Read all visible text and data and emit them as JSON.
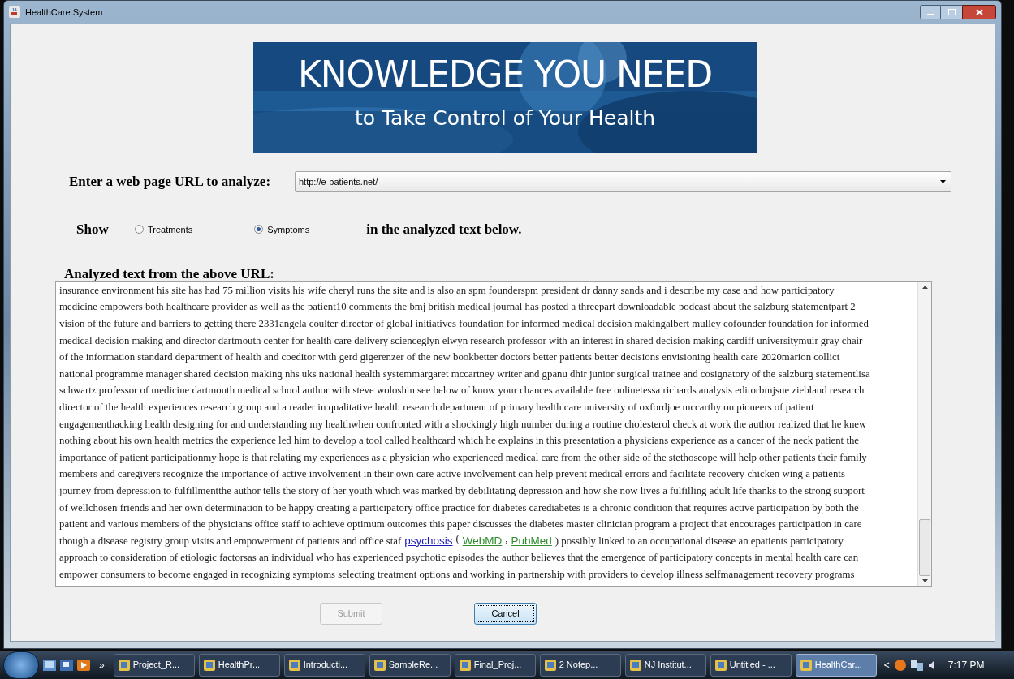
{
  "window": {
    "title": "HealthCare System"
  },
  "banner": {
    "kind": "picture",
    "headline": "KNOWLEDGE YOU NEED",
    "tagline": "to Take Control of Your Health"
  },
  "url_row": {
    "label": "Enter a web page URL to analyze:",
    "value": "http://e-patients.net/"
  },
  "show_row": {
    "label": "Show",
    "suffix": "in the analyzed text below.",
    "options": [
      {
        "label": "Treatments",
        "selected": false
      },
      {
        "label": "Symptoms",
        "selected": true
      }
    ]
  },
  "analyzed": {
    "heading": "Analyzed text from the above URL:",
    "lines": [
      [
        {
          "kind": "text",
          "text": "insurance environment his site has had 75 million visits his wife cheryl runs the site and is also an spm founderspm president dr danny sands and i describe my case and how participatory"
        }
      ],
      [
        {
          "kind": "text",
          "text": "medicine empowers both healthcare provider as well as the patient10 comments the bmj british medical journal has posted a threepart downloadable podcast about the salzburg statementpart 2"
        }
      ],
      [
        {
          "kind": "text",
          "text": "vision of the future and barriers to getting there 2331angela coulter director of global initiatives foundation for informed medical decision makingalbert mulley cofounder foundation for informed"
        }
      ],
      [
        {
          "kind": "text",
          "text": "medical decision making and director dartmouth center for health care delivery scienceglyn elwyn research professor with an interest in shared decision making cardiff universitymuir gray chair"
        }
      ],
      [
        {
          "kind": "text",
          "text": "of the information standard department of health and coeditor with gerd gigerenzer of the new bookbetter doctors better patients better decisions envisioning health care 2020marion collict"
        }
      ],
      [
        {
          "kind": "text",
          "text": "national programme manager shared decision making nhs uks national health systemmargaret mccartney writer and gpanu dhir junior surgical trainee and cosignatory of the salzburg statementlisa"
        }
      ],
      [
        {
          "kind": "text",
          "text": "schwartz professor of medicine dartmouth medical school author with steve woloshin see below of know your chances available free onlinetessa richards analysis editorbmjsue ziebland research"
        }
      ],
      [
        {
          "kind": "text",
          "text": "director of the health experiences research group and a reader in qualitative health research department of primary health care university of oxfordjoe mccarthy on pioneers of patient"
        }
      ],
      [
        {
          "kind": "text",
          "text": "engagementhacking health designing for and understanding my healthwhen confronted with a shockingly high number during a routine cholesterol check at work the author realized that he knew"
        }
      ],
      [
        {
          "kind": "text",
          "text": "nothing about his own health metrics the experience led him to develop a tool called healthcard which he explains in this presentation a physicians experience as a cancer of the neck patient the"
        }
      ],
      [
        {
          "kind": "text",
          "text": "importance of patient participationmy hope is that relating my experiences as a physician who experienced medical care from the other side of the stethoscope will help other patients their family"
        }
      ],
      [
        {
          "kind": "text",
          "text": "members and caregivers recognize the importance of active involvement in their own care active involvement can help prevent medical errors and facilitate recovery chicken wing a patients"
        }
      ],
      [
        {
          "kind": "text",
          "text": "journey from depression to fulfillmentthe author tells the story of her youth which was marked by debilitating depression and how she now lives a fulfilling adult life thanks to the strong support"
        }
      ],
      [
        {
          "kind": "text",
          "text": "of wellchosen friends and her own determination to be happy creating a participatory office practice for diabetes carediabetes is a chronic condition that requires active participation by both the"
        }
      ],
      [
        {
          "kind": "text",
          "text": "patient and various members of the physicians office staff to achieve optimum outcomes this paper discusses the diabetes master clinician program a project that encourages participation in care"
        }
      ],
      [
        {
          "kind": "text",
          "text": "though a disease registry group visits and empowerment of patients and office staf"
        },
        {
          "kind": "link",
          "text": "psychosis",
          "color": "#1a1ab8"
        },
        {
          "kind": "text",
          "text": "("
        },
        {
          "kind": "link",
          "text": "WebMD",
          "color": "#2e8b2e"
        },
        {
          "kind": "text",
          "text": ","
        },
        {
          "kind": "link",
          "text": "PubMed",
          "color": "#2e8b2e"
        },
        {
          "kind": "text",
          "text": ") possibly linked to an occupational disease an epatients participatory"
        }
      ],
      [
        {
          "kind": "text",
          "text": "approach to consideration of etiologic factorsas an individual who has experienced psychotic episodes the author believes that the emergence of participatory concepts in mental health care can"
        }
      ],
      [
        {
          "kind": "text",
          "text": "empower consumers to become engaged in recognizing symptoms selecting treatment options and working in partnership with providers to develop illness selfmanagement recovery programs"
        }
      ]
    ]
  },
  "buttons": [
    {
      "label": "Submit",
      "disabled": true
    },
    {
      "label": "Cancel",
      "disabled": false
    }
  ],
  "taskbar": {
    "tasks": [
      {
        "label": "Project_R...",
        "selected": false
      },
      {
        "label": "HealthPr...",
        "selected": false
      },
      {
        "label": "Introducti...",
        "selected": false
      },
      {
        "label": "SampleRe...",
        "selected": false
      },
      {
        "label": "Final_Proj...",
        "selected": false
      },
      {
        "label": "2 Notep...",
        "selected": false
      },
      {
        "label": "NJ Institut...",
        "selected": false
      },
      {
        "label": "Untitled - ...",
        "selected": false
      },
      {
        "label": "HealthCar...",
        "selected": true
      }
    ],
    "overflow": "»",
    "scroll_left": "<",
    "clock": "7:17 PM"
  }
}
